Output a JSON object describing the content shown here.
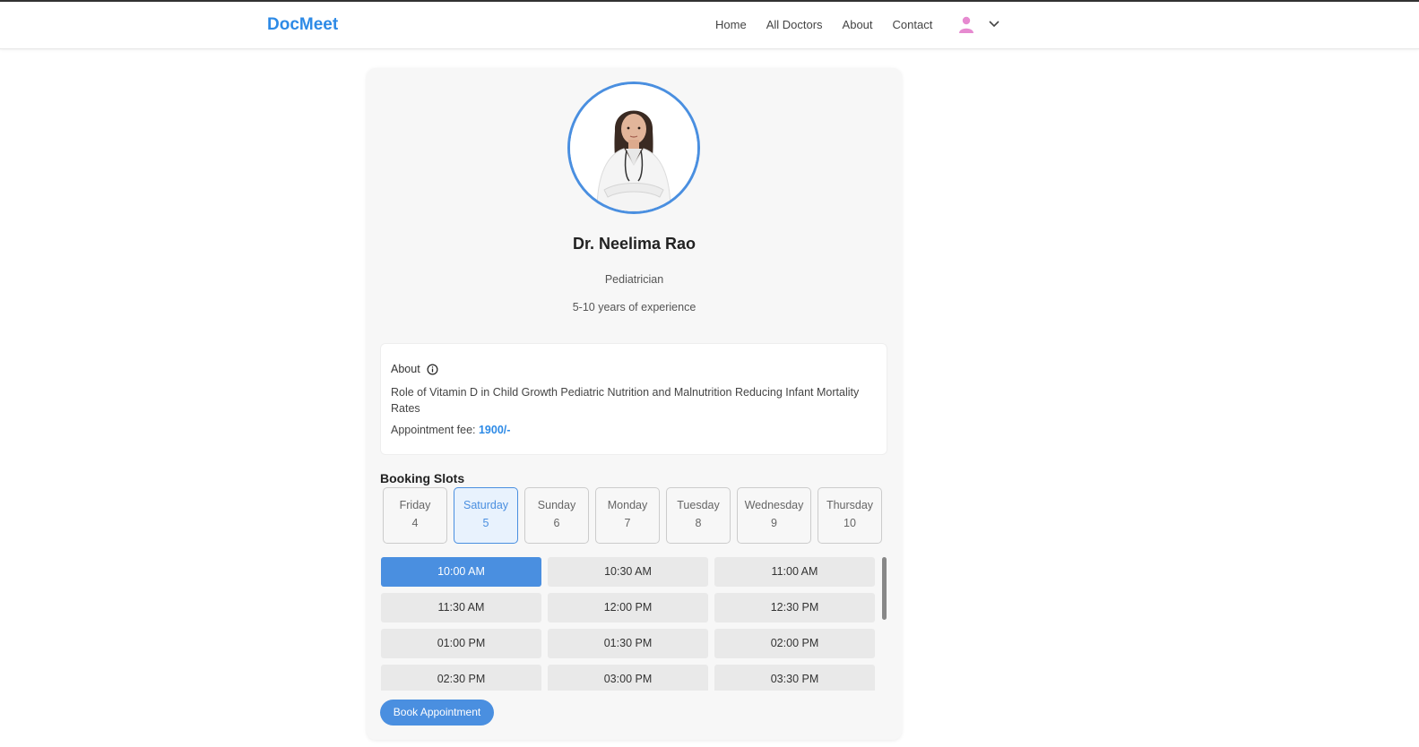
{
  "brand": "DocMeet",
  "nav": {
    "links": [
      "Home",
      "All Doctors",
      "About",
      "Contact"
    ]
  },
  "doctor": {
    "name": "Dr. Neelima Rao",
    "speciality": "Pediatrician",
    "experience": "5-10 years of experience",
    "about_title": "About",
    "about_text": "Role of Vitamin D in Child Growth Pediatric Nutrition and Malnutrition Reducing Infant Mortality Rates",
    "fee_label": "Appointment fee: ",
    "fee_value": "1900/-"
  },
  "booking": {
    "title": "Booking Slots",
    "days": [
      {
        "name": "Friday",
        "date": "4"
      },
      {
        "name": "Saturday",
        "date": "5",
        "selected": true
      },
      {
        "name": "Sunday",
        "date": "6"
      },
      {
        "name": "Monday",
        "date": "7"
      },
      {
        "name": "Tuesday",
        "date": "8"
      },
      {
        "name": "Wednesday",
        "date": "9"
      },
      {
        "name": "Thursday",
        "date": "10"
      }
    ],
    "times": [
      "10:00 AM",
      "10:30 AM",
      "11:00 AM",
      "11:30 AM",
      "12:00 PM",
      "12:30 PM",
      "01:00 PM",
      "01:30 PM",
      "02:00 PM",
      "02:30 PM",
      "03:00 PM",
      "03:30 PM"
    ],
    "selected_time": "10:00 AM",
    "button": "Book Appointment"
  },
  "colors": {
    "accent": "#4a8fe0",
    "brand": "#2d8ae6"
  }
}
